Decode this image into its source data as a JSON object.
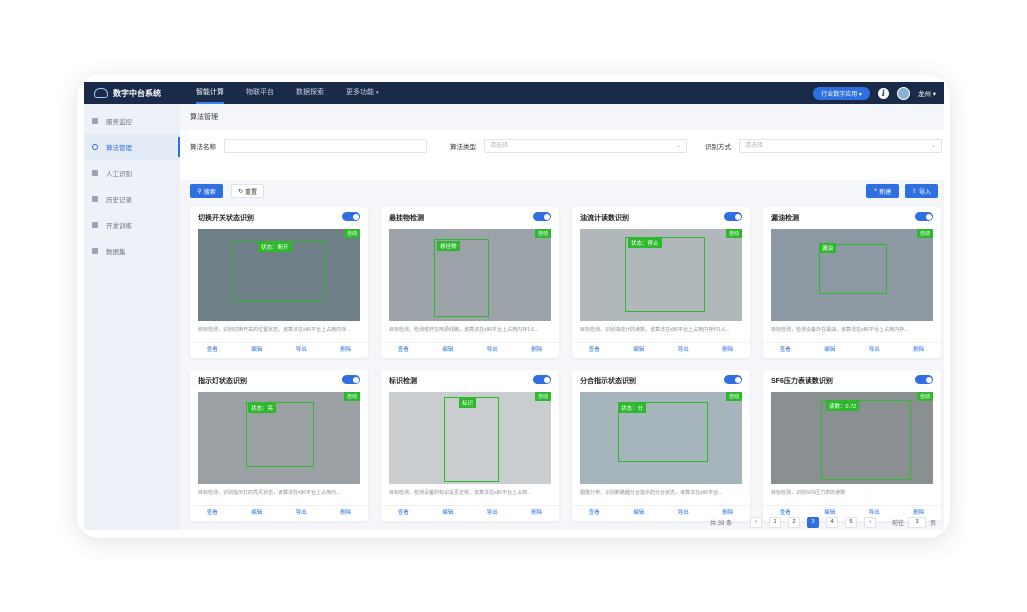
{
  "app": {
    "title": "数字中台系统",
    "user": "龙州",
    "industry_btn": "行业数字应用"
  },
  "nav": [
    "智能计算",
    "物联平台",
    "数据探索",
    "更多功能"
  ],
  "sidebar": [
    "服务监控",
    "算法管理",
    "人工识别",
    "历史记录",
    "开发训练",
    "数据集"
  ],
  "breadcrumb": "算法管理",
  "filter": {
    "name_label": "算法名称",
    "type_label": "算法类型",
    "type_placeholder": "请选择",
    "mode_label": "识别方式",
    "mode_placeholder": "请选择",
    "search": "搜索",
    "reset": "重置",
    "new": "新建",
    "import": "导入"
  },
  "cards": [
    {
      "title": "切换开关状态识别",
      "badge": "自动",
      "label": "状态：断开",
      "desc": "目标检测，识别切换开关的位置状态，该算法在x86平台上占用内存...",
      "bg": "#6f7f88"
    },
    {
      "title": "悬挂物检测",
      "badge": "自动",
      "label": "悬挂物",
      "desc": "目标检测，检测塔杆在电源线路，该算法在x86平台上占用内存1.6...",
      "bg": "#9ba3a8"
    },
    {
      "title": "油流计读数识别",
      "badge": "自动",
      "label": "状态：停止",
      "desc": "目标检测，识别油流计的读数，该算法在x86平台上占用内存约1.6...",
      "bg": "#b0b8bb"
    },
    {
      "title": "漏油检测",
      "badge": "自动",
      "label": "漏油",
      "desc": "目标检测，检测设备外在漏油，该算法在x86平台上占用内存...",
      "bg": "#8e9aa3"
    },
    {
      "title": "指示灯状态识别",
      "badge": "自动",
      "label": "状态：亮",
      "desc": "目标检测，识别指示灯的亮灭状态，该算法在x86平台上占用内...",
      "bg": "#9aa0a4"
    },
    {
      "title": "标识检测",
      "badge": "自动",
      "label": "标识",
      "desc": "目标检测，检测设备的标识是否正常，该算法在x86平台上占用...",
      "bg": "#c9cdd0"
    },
    {
      "title": "分合指示状态识别",
      "badge": "自动",
      "label": "状态：分",
      "desc": "图像分类，识别断路器分合指示的分合状态，该算法在x86平台...",
      "bg": "#a6b4bc"
    },
    {
      "title": "SF6压力表读数识别",
      "badge": "自动",
      "label": "读数：0.72",
      "desc": "目标检测，识别SF6压力表的读数",
      "bg": "#8a8f92"
    }
  ],
  "card_actions": [
    "查看",
    "编辑",
    "导出",
    "删除"
  ],
  "pager": {
    "total": "共 39 条",
    "pages": [
      "1",
      "2",
      "3",
      "4",
      "5"
    ],
    "current": "3",
    "goto_label": "前往",
    "goto_value": "3",
    "page_suffix": "页"
  }
}
